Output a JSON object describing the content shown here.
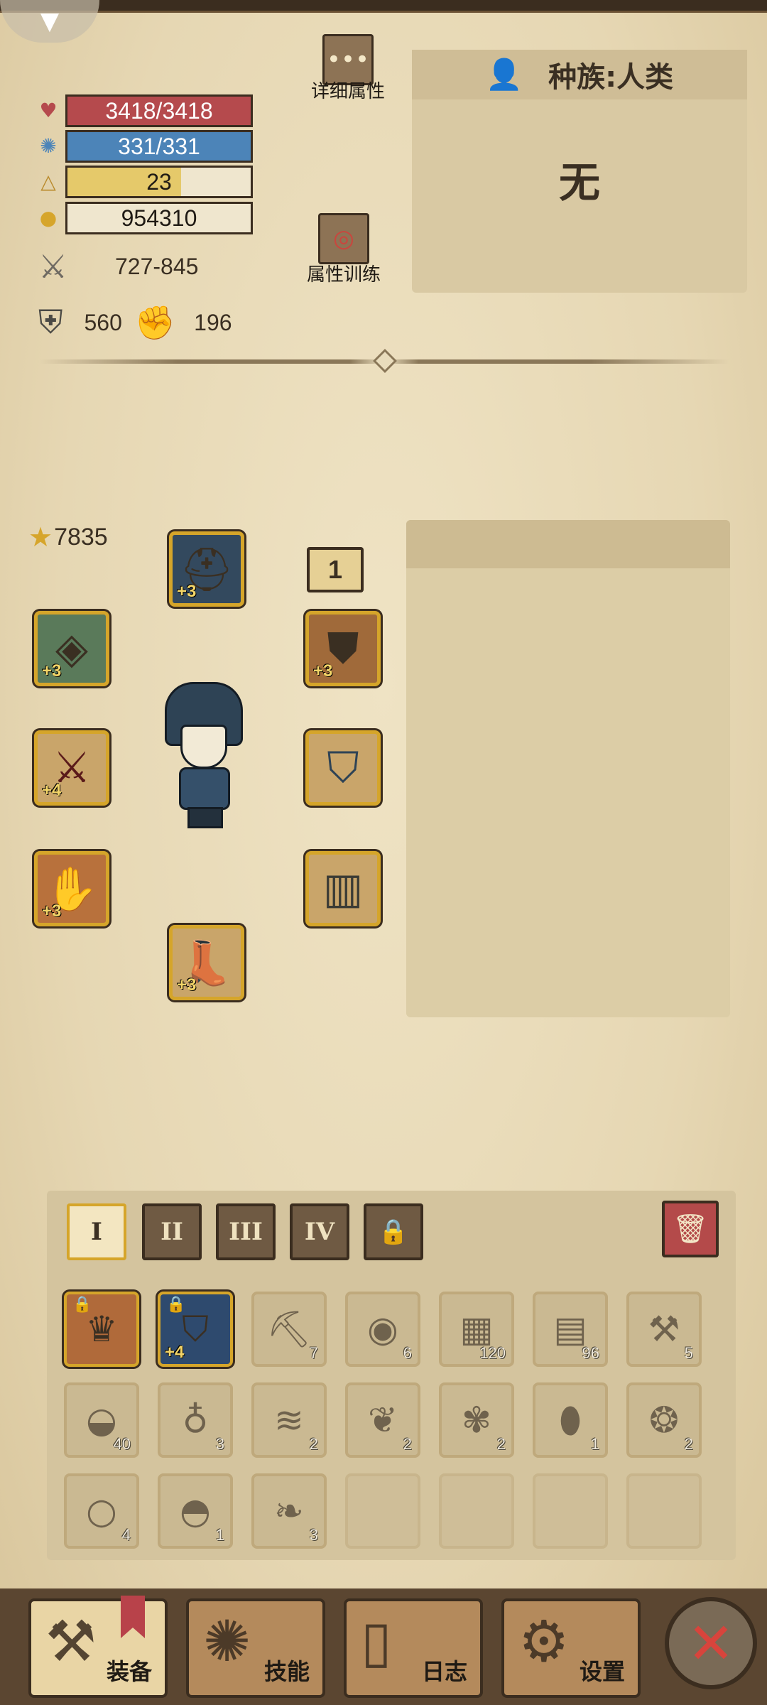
{
  "stats": {
    "hp": "3418/3418",
    "hp_fraction": 1.0,
    "mp": "331/331",
    "mp_fraction": 1.0,
    "level": "23",
    "level_fraction": 0.62,
    "gold": "954310",
    "attack": "727-845",
    "defense": "560",
    "power": "196"
  },
  "buttons": {
    "details_label": "详细属性",
    "training_label": "属性训练"
  },
  "race": {
    "title": "种族:人类",
    "value": "无"
  },
  "equipment": {
    "score": "7835",
    "badge": "1",
    "slots": [
      {
        "name": "helmet",
        "plus": "+3"
      },
      {
        "name": "ring",
        "plus": "+3"
      },
      {
        "name": "amulet",
        "plus": "+3"
      },
      {
        "name": "weapon",
        "plus": "+4"
      },
      {
        "name": "cape",
        "plus": ""
      },
      {
        "name": "gloves",
        "plus": "+3"
      },
      {
        "name": "pants",
        "plus": ""
      },
      {
        "name": "boots",
        "plus": "+3"
      }
    ]
  },
  "inventory": {
    "tabs": [
      "I",
      "II",
      "III",
      "IV"
    ],
    "items": [
      {
        "count": "",
        "plus": "",
        "locked": true
      },
      {
        "count": "",
        "plus": "+4",
        "locked": true
      },
      {
        "count": "7"
      },
      {
        "count": "6"
      },
      {
        "count": "120"
      },
      {
        "count": "96"
      },
      {
        "count": "5"
      },
      {
        "count": "40"
      },
      {
        "count": "3"
      },
      {
        "count": "2"
      },
      {
        "count": "2"
      },
      {
        "count": "2"
      },
      {
        "count": "1"
      },
      {
        "count": "2"
      },
      {
        "count": "4"
      },
      {
        "count": "1"
      },
      {
        "count": "3"
      }
    ]
  },
  "nav": {
    "equip": "装备",
    "skills": "技能",
    "log": "日志",
    "settings": "设置"
  },
  "colors": {
    "hp": "#b54a4d",
    "mp": "#4c84b8",
    "level": "#e5c96a",
    "gold_border": "#d5a52a"
  }
}
